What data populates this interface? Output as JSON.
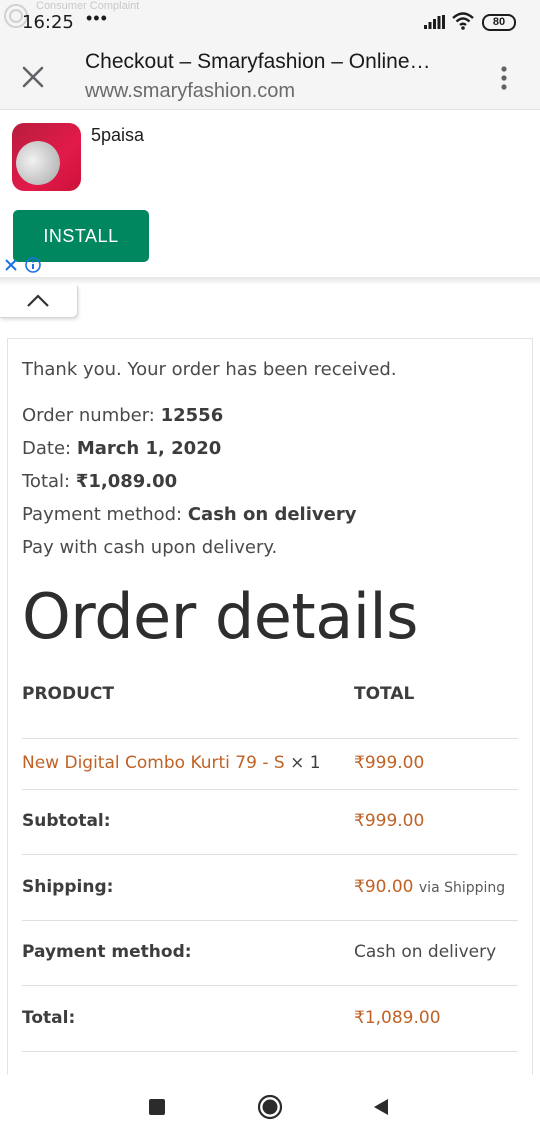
{
  "status_bar": {
    "time": "16:25",
    "dots": "•••",
    "overlay_text": "Consumer Complaint",
    "battery": "80"
  },
  "browser": {
    "title": "Checkout – Smaryfashion – Online…",
    "url": "www.smaryfashion.com"
  },
  "ad": {
    "app_name": "5paisa",
    "install_label": "INSTALL"
  },
  "order": {
    "thank_you": "Thank you. Your order has been received.",
    "number_label": "Order number:",
    "number_value": "12556",
    "date_label": "Date:",
    "date_value": "March 1, 2020",
    "total_label": "Total:",
    "total_value": "₹1,089.00",
    "payment_label": "Payment method:",
    "payment_value": "Cash on delivery",
    "pay_note": "Pay with cash upon delivery."
  },
  "details": {
    "heading": "Order details",
    "col_product": "PRODUCT",
    "col_total": "TOTAL",
    "item_name": "New Digital Combo Kurti 79 - S",
    "item_qty": "× 1",
    "item_price": "₹999.00",
    "subtotal_label": "Subtotal:",
    "subtotal_value": "₹999.00",
    "shipping_label": "Shipping:",
    "shipping_value": "₹90.00",
    "shipping_note": "via Shipping",
    "payment_label": "Payment method:",
    "payment_value": "Cash on delivery",
    "total_label": "Total:",
    "total_value": "₹1,089.00"
  },
  "colors": {
    "accent": "#c06226",
    "install_green": "#01875f",
    "brand_red": "#e21a4a"
  }
}
